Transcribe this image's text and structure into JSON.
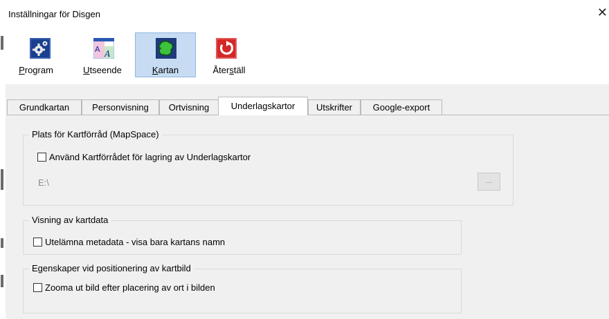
{
  "window": {
    "title": "Inställningar för Disgen",
    "close_glyph": "✕"
  },
  "toolbar": {
    "buttons": [
      {
        "pre": "",
        "u": "P",
        "post": "rogram",
        "icon": "gear-icon",
        "active": false
      },
      {
        "pre": "",
        "u": "U",
        "post": "tseende",
        "icon": "font-appearance-icon",
        "active": false
      },
      {
        "pre": "",
        "u": "K",
        "post": "artan",
        "icon": "map-icon",
        "active": true
      },
      {
        "pre": "Åter",
        "u": "s",
        "post": "täll",
        "icon": "reset-icon",
        "active": false
      }
    ]
  },
  "tabs": [
    "Grundkartan",
    "Personvisning",
    "Ortvisning",
    "Underlagskartor",
    "Utskrifter",
    "Google-export"
  ],
  "active_tab": "Underlagskartor",
  "groups": {
    "mapspace": {
      "legend": "Plats för Kartförråd (MapSpace)",
      "checkbox_label": "Använd Kartförrådet för lagring av Underlagskartor",
      "checked": false,
      "path_value": "E:\\",
      "browse_label": "..."
    },
    "display": {
      "legend": "Visning av kartdata",
      "checkbox_label": "Utelämna metadata - visa bara kartans namn",
      "checked": false
    },
    "positioning": {
      "legend": "Egenskaper vid positionering av kartbild",
      "checkbox_label": "Zooma ut bild efter placering av ort i bilden",
      "checked": false
    }
  },
  "colors": {
    "active_toolbar_bg": "#c7dcf2",
    "panel_bg": "#f0f0f0",
    "tab_border": "#b9b9b9",
    "group_border": "#dadada"
  }
}
